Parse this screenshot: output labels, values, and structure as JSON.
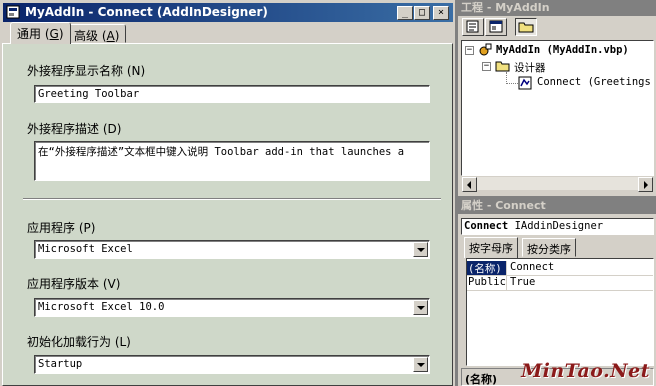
{
  "window": {
    "title": "MyAddIn - Connect (AddInDesigner)",
    "controls": {
      "minimize": "_",
      "maximize": "□",
      "close": "×"
    }
  },
  "tabs": [
    {
      "label": "通用 ",
      "key": "G",
      "suffix": "",
      "wrap_open": "(",
      "wrap_close": ")"
    },
    {
      "label": "高级 ",
      "key": "A",
      "suffix": "",
      "wrap_open": "(",
      "wrap_close": ")"
    }
  ],
  "form": {
    "display_name": {
      "label": "外接程序显示名称 (N)",
      "value": "Greeting Toolbar"
    },
    "description": {
      "label": "外接程序描述 (D)",
      "value": "在“外接程序描述”文本框中键入说明 Toolbar add-in that launches a"
    },
    "application": {
      "label": "应用程序 (P)",
      "value": "Microsoft Excel"
    },
    "app_version": {
      "label": "应用程序版本 (V)",
      "value": "Microsoft Excel 10.0"
    },
    "load_behavior": {
      "label": "初始化加载行为 (L)",
      "value": "Startup"
    }
  },
  "project": {
    "title": "工程 - MyAddIn",
    "tree": [
      {
        "text": "MyAddIn (MyAddIn.vbp)",
        "expander": "−"
      },
      {
        "text": "设计器",
        "expander": "−"
      },
      {
        "text": "Connect (Greetings.Dsr)"
      }
    ]
  },
  "properties": {
    "title": "属性 - Connect",
    "object_name": "Connect",
    "object_type": "IAddinDesigner",
    "tabs": [
      "按字母序",
      "按分类序"
    ],
    "rows": [
      {
        "name": "(名称)",
        "value": "Connect",
        "selected": true
      },
      {
        "name": "Public",
        "value": "True",
        "selected": false
      }
    ],
    "description": "(名称)"
  },
  "watermark": "MinTao.Net",
  "colors": {
    "title_active": "#0a246a",
    "title_inactive": "#808080",
    "form_background": "#cfd8c9",
    "chrome": "#d4d0c8",
    "watermark": "#8b1a1a"
  }
}
